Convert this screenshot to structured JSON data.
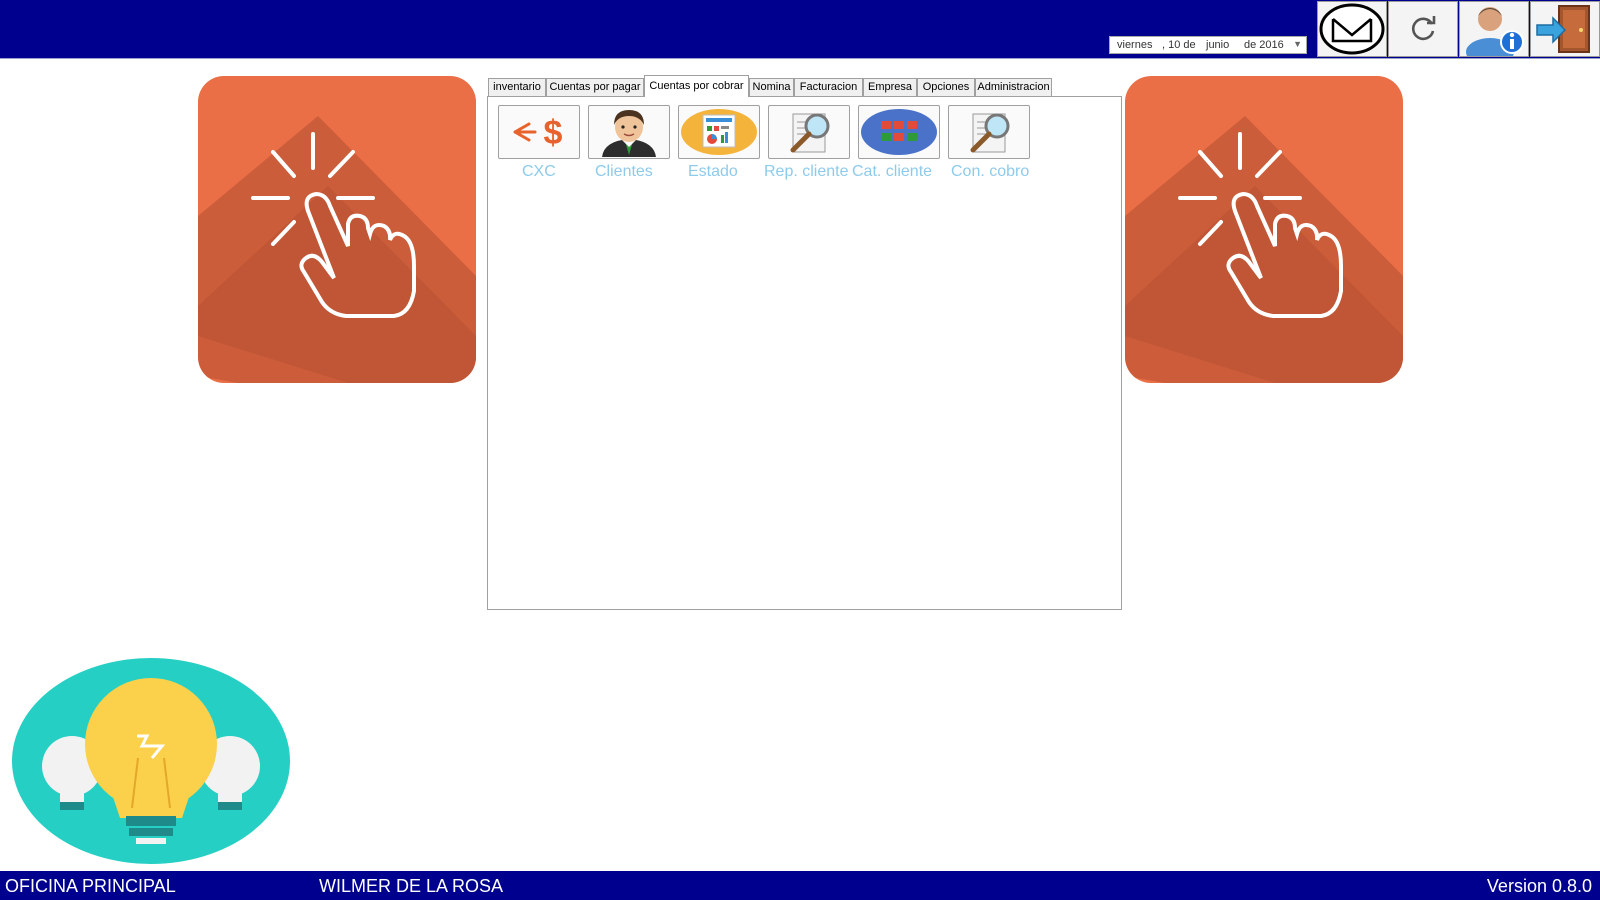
{
  "date_picker": {
    "weekday": "viernes",
    "day": ", 10 de",
    "month": "junio",
    "year": "de 2016"
  },
  "top_buttons": [
    {
      "name": "mail-button",
      "icon": "envelope-icon"
    },
    {
      "name": "refresh-button",
      "icon": "refresh-icon"
    },
    {
      "name": "user-info-button",
      "icon": "user-info-icon"
    },
    {
      "name": "exit-button",
      "icon": "exit-door-icon"
    }
  ],
  "tabs": [
    {
      "label": "inventario"
    },
    {
      "label": "Cuentas por pagar"
    },
    {
      "label": "Cuentas por cobrar"
    },
    {
      "label": "Nomina"
    },
    {
      "label": "Facturacion"
    },
    {
      "label": "Empresa"
    },
    {
      "label": "Opciones"
    },
    {
      "label": "Administracion"
    }
  ],
  "active_tab": "Cuentas por cobrar",
  "tools": [
    {
      "label": "CXC",
      "icon": "money-arrow-icon"
    },
    {
      "label": "Clientes",
      "icon": "client-person-icon"
    },
    {
      "label": "Estado",
      "icon": "report-chart-icon"
    },
    {
      "label": "Rep. cliente",
      "icon": "magnifier-document-icon"
    },
    {
      "label": "Cat. cliente",
      "icon": "catalog-icon"
    },
    {
      "label": "Con. cobro",
      "icon": "magnifier-document-icon"
    }
  ],
  "status": {
    "office": "OFICINA PRINCIPAL",
    "user": "WILMER DE LA ROSA",
    "version": "Version 0.8.0"
  },
  "colors": {
    "topbar": "#00008e",
    "click_panel": "#ea6e46",
    "bulb_bg": "#26cfc4",
    "tool_label": "#8ecbea"
  }
}
